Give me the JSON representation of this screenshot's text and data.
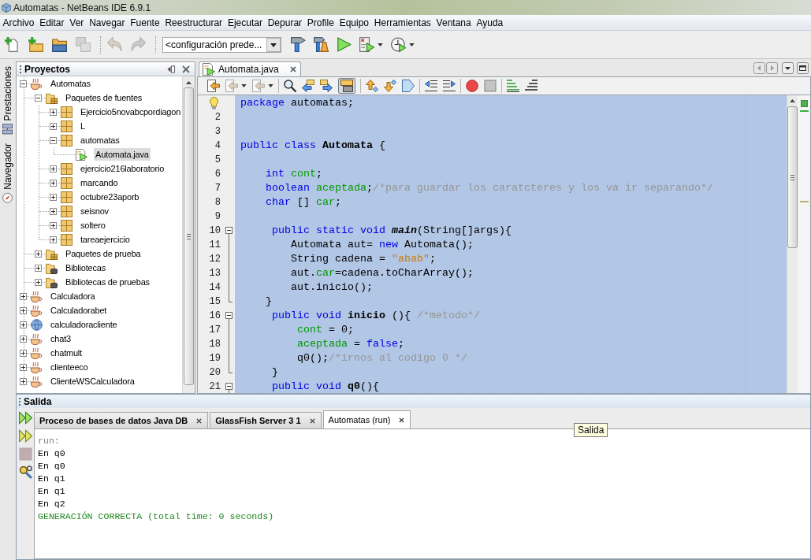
{
  "window": {
    "title": "Automatas - NetBeans IDE 6.9.1"
  },
  "menu_bar": [
    "Archivo",
    "Editar",
    "Ver",
    "Navegar",
    "Fuente",
    "Reestructurar",
    "Ejecutar",
    "Depurar",
    "Profile",
    "Equipo",
    "Herramientas",
    "Ventana",
    "Ayuda"
  ],
  "toolbar": {
    "file_buttons": [
      {
        "kind": "new-file",
        "disabled": false
      },
      {
        "kind": "new-project",
        "disabled": false
      },
      {
        "kind": "open-project",
        "disabled": false
      },
      {
        "kind": "save-all",
        "disabled": true
      }
    ],
    "edit_buttons": [
      {
        "kind": "undo",
        "disabled": true
      },
      {
        "kind": "redo",
        "disabled": true
      }
    ],
    "configuration": "<configuración prede...",
    "run_buttons": [
      {
        "kind": "build",
        "disabled": false
      },
      {
        "kind": "clean-build",
        "disabled": false
      },
      {
        "kind": "run",
        "disabled": false
      },
      {
        "kind": "debug",
        "disabled": false,
        "has_menu": true
      },
      {
        "kind": "profile",
        "disabled": false,
        "has_menu": true
      }
    ]
  },
  "side_tabs": [
    {
      "kind": "services",
      "label": "Prestaciones"
    },
    {
      "kind": "navigator",
      "label": "Navegador"
    }
  ],
  "projects": {
    "title": "Proyectos",
    "tree": [
      {
        "label": "Automatas",
        "kind": "project",
        "expanded": true,
        "selected": false,
        "children": [
          {
            "label": "Paquetes de fuentes",
            "kind": "source-folder",
            "expanded": true,
            "selected": false,
            "children": [
              {
                "label": "Ejercicio5novabcpordiagon",
                "kind": "package",
                "expanded": false,
                "selected": false
              },
              {
                "label": "L",
                "kind": "package",
                "expanded": false,
                "selected": false
              },
              {
                "label": "automatas",
                "kind": "package",
                "expanded": true,
                "selected": false,
                "children": [
                  {
                    "label": "Automata.java",
                    "kind": "java-file",
                    "selected": true
                  }
                ]
              },
              {
                "label": "ejercicio216laboratorio",
                "kind": "package",
                "expanded": false,
                "selected": false
              },
              {
                "label": "marcando",
                "kind": "package",
                "expanded": false,
                "selected": false
              },
              {
                "label": "octubre23aporb",
                "kind": "package",
                "expanded": false,
                "selected": false
              },
              {
                "label": "seisnov",
                "kind": "package",
                "expanded": false,
                "selected": false
              },
              {
                "label": "soltero",
                "kind": "package",
                "expanded": false,
                "selected": false
              },
              {
                "label": "tareaejercicio",
                "kind": "package",
                "expanded": false,
                "selected": false
              }
            ]
          },
          {
            "label": "Paquetes de prueba",
            "kind": "test-folder",
            "expanded": false,
            "selected": false
          },
          {
            "label": "Bibliotecas",
            "kind": "library",
            "expanded": false,
            "selected": false
          },
          {
            "label": "Bibliotecas de pruebas",
            "kind": "library",
            "expanded": false,
            "selected": false
          }
        ]
      },
      {
        "label": "Calculadora",
        "kind": "project",
        "expanded": false,
        "selected": false
      },
      {
        "label": "Calculadorabet",
        "kind": "project",
        "expanded": false,
        "selected": false
      },
      {
        "label": "calculadoracliente",
        "kind": "web-project",
        "expanded": false,
        "selected": false
      },
      {
        "label": "chat3",
        "kind": "project",
        "expanded": false,
        "selected": false
      },
      {
        "label": "chatmult",
        "kind": "project",
        "expanded": false,
        "selected": false
      },
      {
        "label": "clienteeco",
        "kind": "project",
        "expanded": false,
        "selected": false
      },
      {
        "label": "ClienteWSCalculadora",
        "kind": "project",
        "expanded": false,
        "selected": false
      }
    ]
  },
  "editor": {
    "tabs": [
      {
        "label": "Automata.java",
        "selected": true
      }
    ],
    "toolbar": [
      [
        {
          "kind": "last-edit",
          "disabled": false
        },
        {
          "kind": "back",
          "disabled": true,
          "has_menu": true
        },
        {
          "kind": "forward",
          "disabled": true,
          "has_menu": true
        }
      ],
      [
        {
          "kind": "find-selection",
          "disabled": false
        },
        {
          "kind": "find-previous",
          "disabled": false
        },
        {
          "kind": "find-next",
          "disabled": false
        },
        {
          "kind": "toggle-highlight",
          "disabled": false,
          "pressed": true
        }
      ],
      [
        {
          "kind": "previous-bookmark",
          "disabled": false
        },
        {
          "kind": "next-bookmark",
          "disabled": false
        },
        {
          "kind": "toggle-bookmark",
          "disabled": false
        }
      ],
      [
        {
          "kind": "shift-left",
          "disabled": false
        },
        {
          "kind": "shift-right",
          "disabled": false
        }
      ],
      [
        {
          "kind": "start-macro",
          "disabled": false
        },
        {
          "kind": "stop-macro",
          "disabled": false
        }
      ],
      [
        {
          "kind": "comment",
          "disabled": false
        },
        {
          "kind": "uncomment",
          "disabled": false
        }
      ]
    ],
    "code_selected": true,
    "lines": [
      {
        "kind": "plain",
        "hint": true,
        "tokens": [
          {
            "kind": "keyword",
            "text": "package"
          },
          {
            "kind": "plain",
            "text": " automatas;"
          }
        ]
      },
      {
        "kind": "plain",
        "number": "2"
      },
      {
        "kind": "plain",
        "number": "3"
      },
      {
        "kind": "plain",
        "number": "4",
        "tokens": [
          {
            "kind": "keyword",
            "text": "public class "
          },
          {
            "kind": "declaration",
            "text": "Automata"
          },
          {
            "kind": "plain",
            "text": " {"
          }
        ]
      },
      {
        "kind": "plain",
        "number": "5"
      },
      {
        "kind": "plain",
        "number": "6",
        "tokens": [
          {
            "kind": "keyword",
            "text": "    int "
          },
          {
            "kind": "field",
            "text": "cont"
          },
          {
            "kind": "plain",
            "text": ";"
          }
        ]
      },
      {
        "kind": "plain",
        "number": "7",
        "tokens": [
          {
            "kind": "keyword",
            "text": "    boolean "
          },
          {
            "kind": "field",
            "text": "aceptada"
          },
          {
            "kind": "plain",
            "text": ";"
          },
          {
            "kind": "comment",
            "text": "/*para guardar los caratcteres y los va ir separando*/"
          }
        ]
      },
      {
        "kind": "plain",
        "number": "8",
        "tokens": [
          {
            "kind": "keyword",
            "text": "    char"
          },
          {
            "kind": "plain",
            "text": " [] "
          },
          {
            "kind": "field",
            "text": "car"
          },
          {
            "kind": "plain",
            "text": ";"
          }
        ]
      },
      {
        "kind": "plain",
        "number": "9"
      },
      {
        "kind": "fold-start",
        "expanded": true,
        "number": "10",
        "tokens": [
          {
            "kind": "keyword",
            "text": "     public static void "
          },
          {
            "kind": "static-declaration",
            "text": "main"
          },
          {
            "kind": "plain",
            "text": "(String[]args){"
          }
        ]
      },
      {
        "kind": "fold-inside",
        "number": "11",
        "tokens": [
          {
            "kind": "plain",
            "text": "        Automata aut= "
          },
          {
            "kind": "keyword",
            "text": "new"
          },
          {
            "kind": "plain",
            "text": " Automata();"
          }
        ]
      },
      {
        "kind": "fold-inside",
        "number": "12",
        "tokens": [
          {
            "kind": "plain",
            "text": "        String cadena = "
          },
          {
            "kind": "string",
            "text": "\"abab\""
          },
          {
            "kind": "plain",
            "text": ";"
          }
        ]
      },
      {
        "kind": "fold-inside",
        "number": "13",
        "tokens": [
          {
            "kind": "plain",
            "text": "        aut."
          },
          {
            "kind": "field",
            "text": "car"
          },
          {
            "kind": "plain",
            "text": "=cadena.toCharArray();"
          }
        ]
      },
      {
        "kind": "fold-inside",
        "number": "14",
        "tokens": [
          {
            "kind": "plain",
            "text": "        aut.inicio();"
          }
        ]
      },
      {
        "kind": "fold-end",
        "number": "15",
        "tokens": [
          {
            "kind": "plain",
            "text": "    }"
          }
        ]
      },
      {
        "kind": "fold-start",
        "expanded": true,
        "number": "16",
        "tokens": [
          {
            "kind": "keyword",
            "text": "     public void "
          },
          {
            "kind": "declaration",
            "text": "inicio"
          },
          {
            "kind": "plain",
            "text": " (){ "
          },
          {
            "kind": "comment",
            "text": "/*metodo*/"
          }
        ]
      },
      {
        "kind": "fold-inside",
        "number": "17",
        "tokens": [
          {
            "kind": "field",
            "text": "         cont"
          },
          {
            "kind": "plain",
            "text": " = 0;"
          }
        ]
      },
      {
        "kind": "fold-inside",
        "number": "18",
        "tokens": [
          {
            "kind": "field",
            "text": "         aceptada"
          },
          {
            "kind": "plain",
            "text": " = "
          },
          {
            "kind": "keyword",
            "text": "false"
          },
          {
            "kind": "plain",
            "text": ";"
          }
        ]
      },
      {
        "kind": "fold-inside",
        "number": "19",
        "tokens": [
          {
            "kind": "plain",
            "text": "         q0();"
          },
          {
            "kind": "comment",
            "text": "/*irnos al codigo 0 */"
          }
        ]
      },
      {
        "kind": "fold-end",
        "number": "20",
        "tokens": [
          {
            "kind": "plain",
            "text": "     }"
          }
        ]
      },
      {
        "kind": "fold-start",
        "expanded": true,
        "number": "21",
        "tokens": [
          {
            "kind": "keyword",
            "text": "     public void "
          },
          {
            "kind": "declaration",
            "text": "q0"
          },
          {
            "kind": "plain",
            "text": "(){"
          }
        ]
      }
    ]
  },
  "output": {
    "title": "Salida",
    "actions": [
      {
        "kind": "rerun",
        "disabled": false
      },
      {
        "kind": "rerun-with-options",
        "disabled": false
      },
      {
        "kind": "stop",
        "disabled": true
      },
      {
        "kind": "settings",
        "disabled": false
      }
    ],
    "tabs": [
      {
        "label": "Proceso de bases de datos Java DB",
        "selected": false,
        "unread": true
      },
      {
        "label": "GlassFish Server 3 1",
        "selected": false,
        "unread": true
      },
      {
        "label": "Automatas (run)",
        "selected": true,
        "unread": false
      }
    ],
    "lines": [
      {
        "kind": "info",
        "text": "run:"
      },
      {
        "kind": "output",
        "text": "En q0"
      },
      {
        "kind": "output",
        "text": "En q0"
      },
      {
        "kind": "output",
        "text": "En q1"
      },
      {
        "kind": "output",
        "text": "En q1"
      },
      {
        "kind": "output",
        "text": "En q2"
      },
      {
        "kind": "success",
        "text": "GENERACIÓN CORRECTA (total time: 0 seconds)"
      }
    ]
  },
  "tooltip": "Salida"
}
